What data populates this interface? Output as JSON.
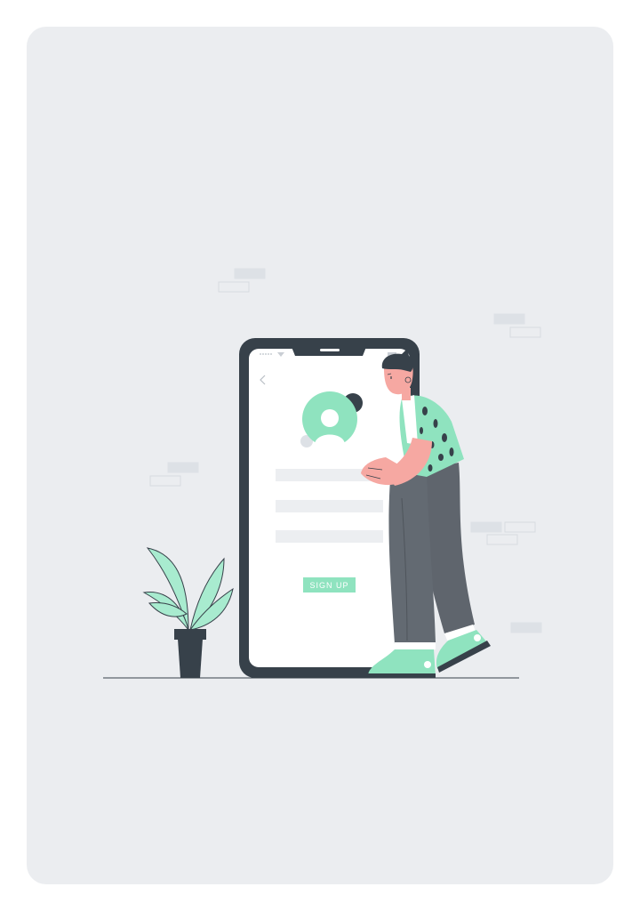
{
  "signup": {
    "label": "SIGN UP"
  },
  "colors": {
    "background": "#ebedf0",
    "phone_frame": "#37414a",
    "screen": "#ffffff",
    "accent": "#8fe3bf",
    "field": "#eceef1"
  }
}
